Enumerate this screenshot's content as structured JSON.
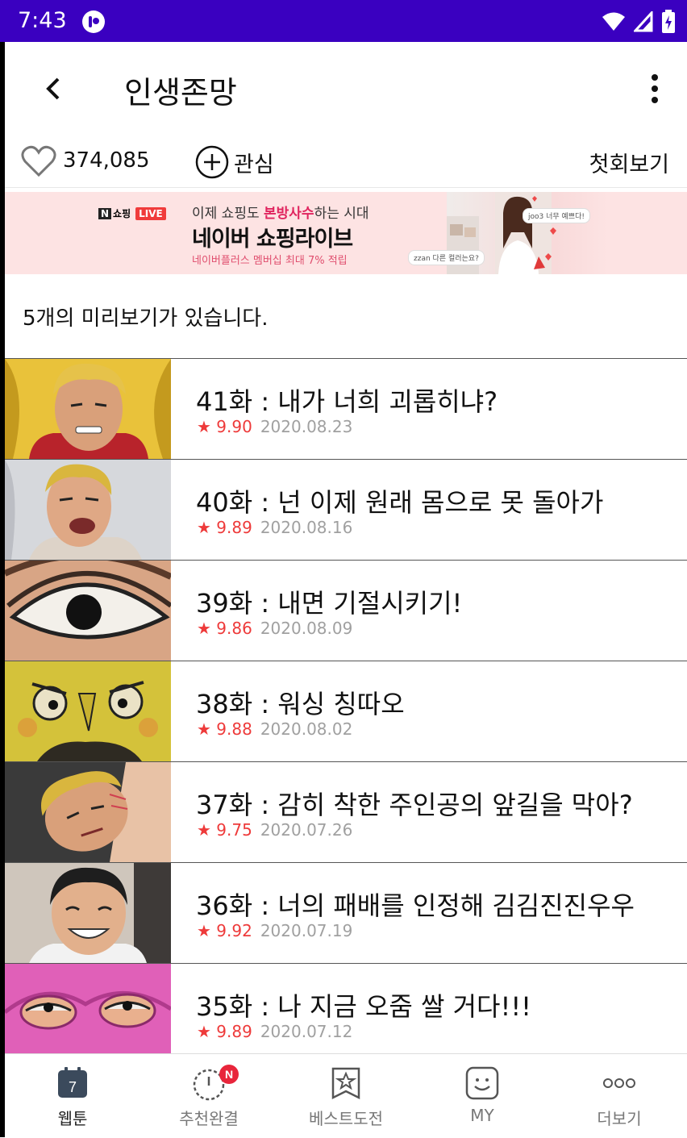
{
  "status_bar": {
    "time": "7:43"
  },
  "app_bar": {
    "title": "인생존망"
  },
  "actions": {
    "like_count": "374,085",
    "favorite_label": "관심",
    "first_episode_label": "첫회보기"
  },
  "banner": {
    "brand": "쇼핑",
    "brand_badge": "LIVE",
    "line1_pre": "이제 쇼핑도 ",
    "line1_highlight": "본방사수",
    "line1_post": "하는 시대",
    "headline": "네이버 쇼핑라이브",
    "subtext": "네이버플러스 멤버십 최대 7% 적립",
    "bubble1": "joo3 너무 예쁘다!",
    "bubble2": "zzan 다른 컬러는요?"
  },
  "preview_info": "5개의 미리보기가 있습니다.",
  "episodes": [
    {
      "title": "41화 : 내가 너희 괴롭히냐?",
      "rating": "9.90",
      "date": "2020.08.23"
    },
    {
      "title": "40화 : 넌 이제 원래 몸으로 못 돌아가",
      "rating": "9.89",
      "date": "2020.08.16"
    },
    {
      "title": "39화 : 내면 기절시키기!",
      "rating": "9.86",
      "date": "2020.08.09"
    },
    {
      "title": "38화 : 워싱 칭따오",
      "rating": "9.88",
      "date": "2020.08.02"
    },
    {
      "title": "37화 : 감히 착한 주인공의 앞길을 막아?",
      "rating": "9.75",
      "date": "2020.07.26"
    },
    {
      "title": "36화 : 너의 패배를 인정해 김김진진우우",
      "rating": "9.92",
      "date": "2020.07.19"
    },
    {
      "title": "35화 : 나 지금 오줌 쌀 거다!!!",
      "rating": "9.89",
      "date": "2020.07.12"
    }
  ],
  "rating_star": "★",
  "bottom_nav": {
    "items": [
      {
        "label": "웹툰",
        "icon_text": "7",
        "icon": "calendar-icon"
      },
      {
        "label": "추천완결",
        "badge": "N",
        "icon": "clock-icon"
      },
      {
        "label": "베스트도전",
        "icon": "bookmark-star-icon"
      },
      {
        "label": "MY",
        "icon": "smiley-icon"
      },
      {
        "label": "더보기",
        "icon": "more-dots-icon"
      }
    ]
  },
  "colors": {
    "status_bar": "#3a00c0",
    "rating": "#ee3a3a",
    "badge": "#e8253b"
  }
}
